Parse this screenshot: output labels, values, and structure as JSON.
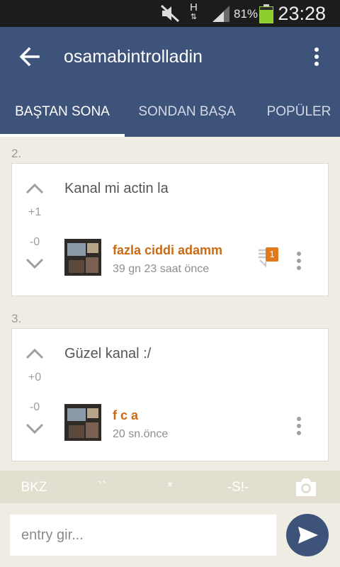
{
  "status_bar": {
    "network_type": "H",
    "battery_percent": "81%",
    "battery_level": 0.81,
    "time": "23:28",
    "icons": [
      "mute-icon",
      "network-arrows-icon",
      "signal-icon",
      "battery-icon"
    ]
  },
  "app_bar": {
    "title": "osamabintrolladin",
    "icons": [
      "back-arrow-icon",
      "overflow-menu-icon"
    ]
  },
  "tabs": [
    {
      "label": "BAŞTAN SONA",
      "active": true
    },
    {
      "label": "SONDAN BAŞA",
      "active": false
    },
    {
      "label": "POPÜLER",
      "active": false
    }
  ],
  "entries": [
    {
      "number": "2.",
      "text": "Kanal mi actin la",
      "upvotes": "+1",
      "downvotes": "-0",
      "author": "fazla ciddi adamm",
      "time": "39 gn 23 saat  önce",
      "reply_count": "1"
    },
    {
      "number": "3.",
      "text": "Güzel kanal :/",
      "upvotes": "+0",
      "downvotes": "-0",
      "author": "f c a",
      "time": "20 sn.önce"
    }
  ],
  "toolbar": {
    "bkz": "BKZ",
    "backticks": "``",
    "asterisk": "*",
    "spoiler": "-S!-",
    "camera_icon": "camera-icon"
  },
  "composer": {
    "placeholder": "entry gir...",
    "send_icon": "send-icon"
  },
  "colors": {
    "primary": "#3d5379",
    "author": "#cb6a12",
    "reply_badge": "#e07a1c",
    "background": "#efede3"
  }
}
